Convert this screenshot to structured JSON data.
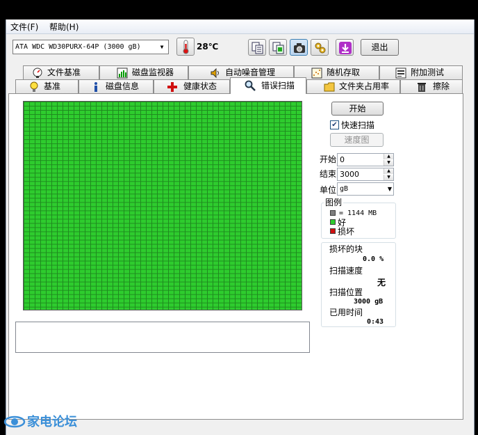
{
  "menu": {
    "file": "文件(F)",
    "help": "帮助(H)"
  },
  "toolbar": {
    "drive": "ATA    WDC WD30PURX-64P (3000 gB)",
    "temperature": "28℃",
    "exit_label": "退出",
    "icons": [
      "copy-icon",
      "copy-info-icon",
      "camera-icon",
      "options-icon",
      "download-icon"
    ]
  },
  "tabs_row1": [
    {
      "label": "文件基准",
      "icon": "benchmark-icon"
    },
    {
      "label": "磁盘监视器",
      "icon": "monitor-icon"
    },
    {
      "label": "自动噪音管理",
      "icon": "speaker-icon"
    },
    {
      "label": "随机存取",
      "icon": "random-access-icon"
    },
    {
      "label": "附加测试",
      "icon": "extra-tests-icon"
    }
  ],
  "tabs_row2": [
    {
      "label": "基准",
      "icon": "benchmark-bulb-icon"
    },
    {
      "label": "磁盘信息",
      "icon": "info-icon"
    },
    {
      "label": "健康状态",
      "icon": "health-cross-icon"
    },
    {
      "label": "错误扫描",
      "icon": "magnifier-icon",
      "active": true
    },
    {
      "label": "文件夹占用率",
      "icon": "folder-icon"
    },
    {
      "label": "擦除",
      "icon": "trash-icon"
    }
  ],
  "scan": {
    "start_button": "开始",
    "quick_scan_label": "快速扫描",
    "quick_scan_checked": true,
    "speed_map_button": "速度图",
    "start_label": "开始",
    "start_value": "0",
    "end_label": "结束",
    "end_value": "3000",
    "unit_label": "单位",
    "unit_value": "gB"
  },
  "legend": {
    "title": "图例",
    "block_size": "= 1144 MB",
    "good": "好",
    "damaged": "损坏",
    "colors": {
      "block": "#808080",
      "good": "#2ecc2e",
      "damaged": "#d01010"
    }
  },
  "stats": {
    "damaged_blocks_label": "损坏的块",
    "damaged_blocks_value": "0.0 %",
    "scan_speed_label": "扫描速度",
    "scan_speed_value": "无",
    "scan_position_label": "扫描位置",
    "scan_position_value": "3000 gB",
    "elapsed_label": "已用时间",
    "elapsed_value": "0:43"
  },
  "watermark": {
    "text": "家电论坛"
  },
  "colors": {
    "grid_fill": "#2ecc2e",
    "grid_line": "#1f8a1f"
  }
}
